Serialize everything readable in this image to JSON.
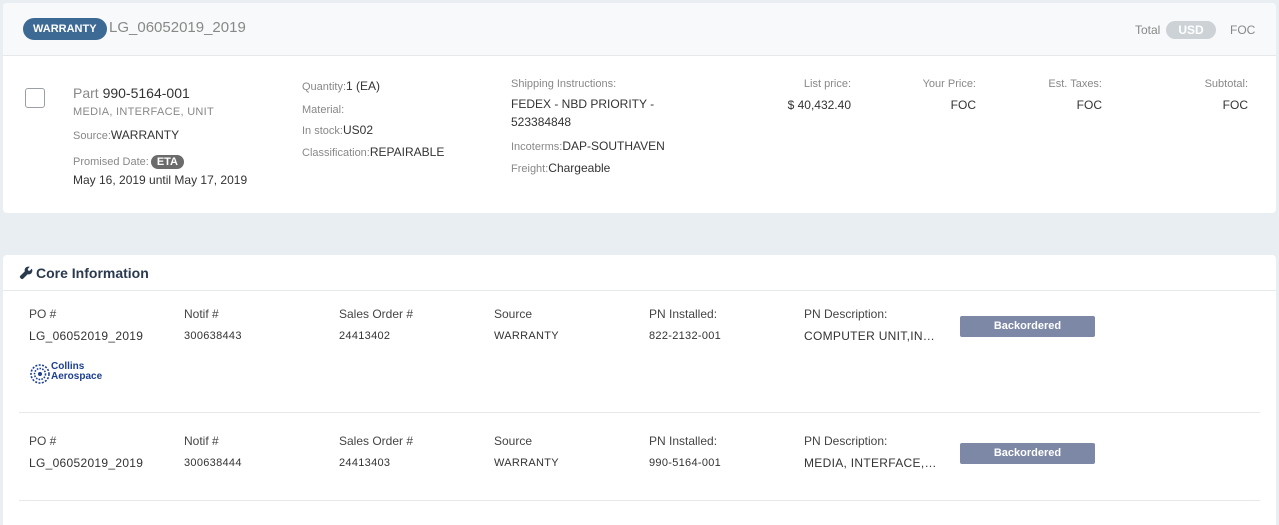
{
  "header": {
    "badge": "WARRANTY",
    "order_id": "LG_06052019_2019",
    "total_label": "Total",
    "currency_active": "USD",
    "currency_other": "FOC"
  },
  "line_item": {
    "part_prefix": "Part",
    "part_number": "990-5164-001",
    "description": "MEDIA, INTERFACE, UNIT",
    "source_label": "Source:",
    "source_value": "WARRANTY",
    "promised_label": "Promised Date:",
    "eta_badge": "ETA",
    "promised_range": "May 16, 2019 until May 17, 2019",
    "quantity_label": "Quantity:",
    "quantity_value": "1 (EA)",
    "material_label": "Material:",
    "material_value": "",
    "stock_label": "In stock:",
    "stock_value": "US02",
    "class_label": "Classification:",
    "class_value": "REPAIRABLE",
    "ship_label": "Shipping Instructions:",
    "ship_line1": "FEDEX - NBD PRIORITY -",
    "ship_line2": "523384848",
    "incoterms_label": "Incoterms:",
    "incoterms_value": "DAP-SOUTHAVEN",
    "freight_label": "Freight:",
    "freight_value": "Chargeable",
    "list_price_label": "List price:",
    "list_price_value": "$ 40,432.40",
    "your_price_label": "Your Price:",
    "your_price_value": "FOC",
    "taxes_label": "Est. Taxes:",
    "taxes_value": "FOC",
    "subtotal_label": "Subtotal:",
    "subtotal_value": "FOC"
  },
  "core": {
    "title": "Core Information",
    "icon": "wrench-icon",
    "columns": [
      "PO #",
      "Notif #",
      "Sales Order #",
      "Source",
      "PN Installed:",
      "PN Description:"
    ],
    "rows": [
      {
        "po": "LG_06052019_2019",
        "notif": "300638443",
        "sales_order": "24413402",
        "source": "WARRANTY",
        "pn_installed": "822-2132-001",
        "pn_description": "COMPUTER UNIT,IN…",
        "status": "Backordered",
        "logo_line1": "Collins",
        "logo_line2": "Aerospace"
      },
      {
        "po": "LG_06052019_2019",
        "notif": "300638444",
        "sales_order": "24413403",
        "source": "WARRANTY",
        "pn_installed": "990-5164-001",
        "pn_description": "MEDIA, INTERFACE,…",
        "status": "Backordered"
      }
    ]
  },
  "colors": {
    "badge_blue": "#3d6a94",
    "status_slate": "#7d88a6",
    "page_bg": "#e9eef2"
  }
}
